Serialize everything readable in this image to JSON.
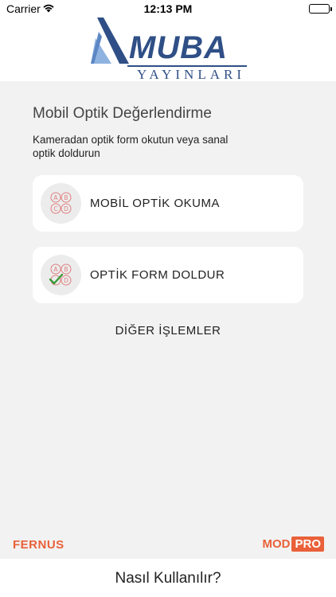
{
  "status_bar": {
    "carrier": "Carrier",
    "time": "12:13 PM",
    "battery_level": 1.0
  },
  "logo": {
    "name": "MUBA",
    "sub": "YAYINLARI",
    "colors": {
      "primary": "#2f4f86",
      "light": "#8fb3e0"
    }
  },
  "main": {
    "title": "Mobil Optik Değerlendirme",
    "subtitle": "Kameradan optik form okutun veya sanal optik doldurun",
    "cards": [
      {
        "label": "MOBİL OPTİK OKUMA",
        "icon": "answer-bubbles-icon"
      },
      {
        "label": "OPTİK FORM DOLDUR",
        "icon": "answer-bubbles-check-icon"
      }
    ],
    "other_label": "DİĞER İŞLEMLER"
  },
  "brands": {
    "left": "FERNUS",
    "right_a": "MOD",
    "right_b": "PRO",
    "accent": "#e9603a"
  },
  "footer": {
    "help_label": "Nasıl Kullanılır?"
  }
}
